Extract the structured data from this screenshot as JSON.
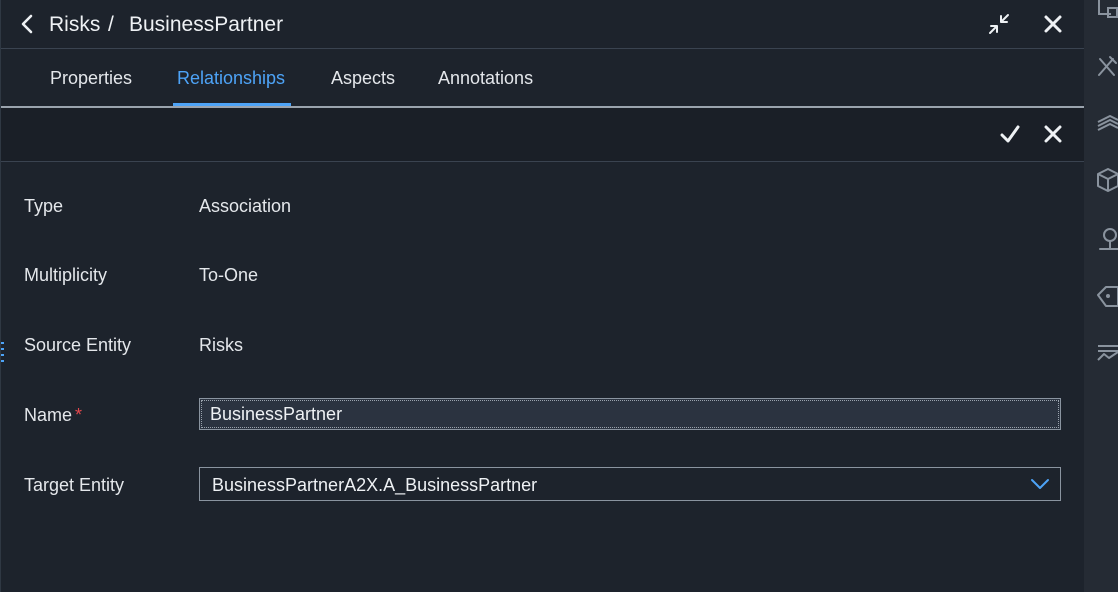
{
  "header": {
    "crumb_parent": "Risks",
    "crumb_separator": "/",
    "crumb_current": "BusinessPartner",
    "back_icon": "chevron-left-icon",
    "collapse_icon": "collapse-arrows-icon",
    "close_icon": "close-icon"
  },
  "tabs": [
    {
      "label": "Properties",
      "active": false
    },
    {
      "label": "Relationships",
      "active": true
    },
    {
      "label": "Aspects",
      "active": false
    },
    {
      "label": "Annotations",
      "active": false
    }
  ],
  "toolbar": {
    "confirm_icon": "checkmark-icon",
    "cancel_icon": "close-icon"
  },
  "form": {
    "type_label": "Type",
    "type_value": "Association",
    "multiplicity_label": "Multiplicity",
    "multiplicity_value": "To-One",
    "source_label": "Source Entity",
    "source_value": "Risks",
    "name_label": "Name",
    "name_required_mark": "*",
    "name_value": "BusinessPartner",
    "target_label": "Target Entity",
    "target_value": "BusinessPartnerA2X.A_BusinessPartner"
  },
  "right_sidebar_icons": [
    "tools-icon",
    "layers-icon",
    "package-icon",
    "map-pin-icon",
    "gem-icon",
    "chart-icon"
  ],
  "colors": {
    "accent": "#4da3f7",
    "background": "#1d232c",
    "required": "#e5484d"
  }
}
